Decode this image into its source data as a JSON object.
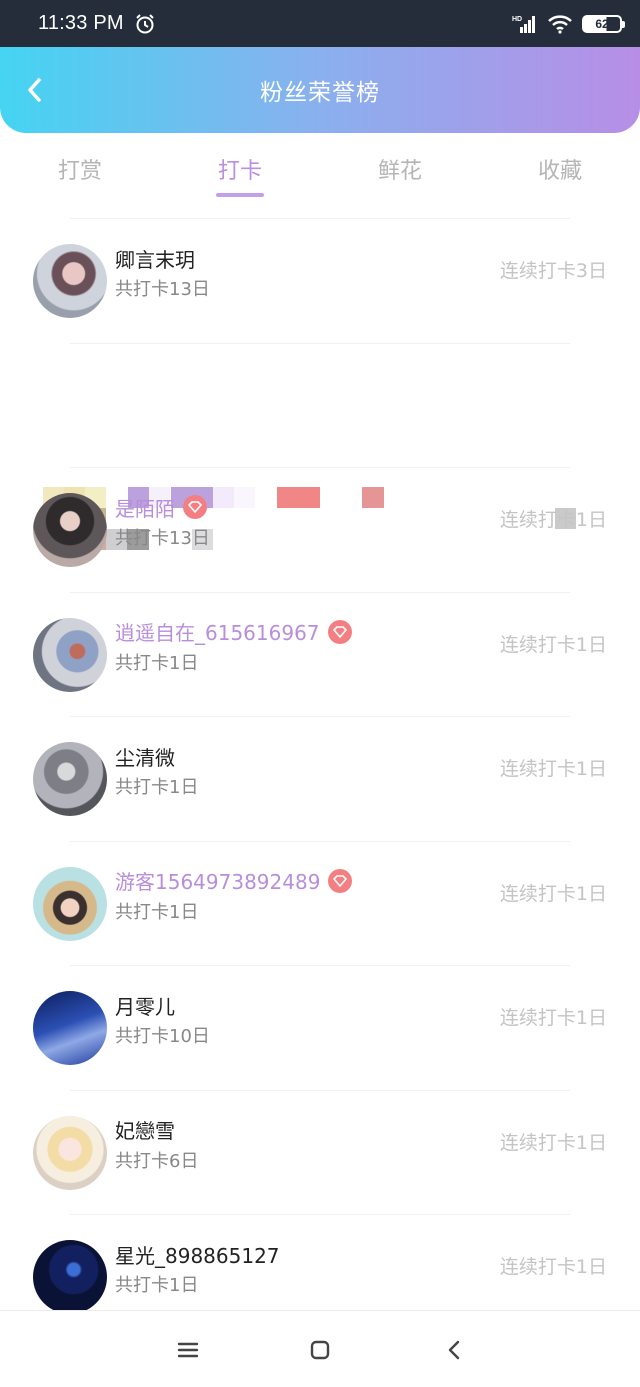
{
  "status_bar": {
    "time": "11:33 PM",
    "battery": "62",
    "network": "HD"
  },
  "header": {
    "title": "粉丝荣誉榜"
  },
  "tabs": [
    {
      "label": "打赏",
      "active": false
    },
    {
      "label": "打卡",
      "active": true
    },
    {
      "label": "鲜花",
      "active": false
    },
    {
      "label": "收藏",
      "active": false
    }
  ],
  "fans": [
    {
      "name": "卿言末玥",
      "total": "共打卡13日",
      "streak": "连续打卡3日",
      "vip": false
    },
    {
      "name": "",
      "total": "",
      "streak": "",
      "vip": false,
      "obscured": true
    },
    {
      "name": "是陌陌",
      "total": "共打卡13日",
      "streak": "连续打卡1日",
      "vip": true
    },
    {
      "name": "逍遥自在_615616967",
      "total": "共打卡1日",
      "streak": "连续打卡1日",
      "vip": true
    },
    {
      "name": "尘清微",
      "total": "共打卡1日",
      "streak": "连续打卡1日",
      "vip": false
    },
    {
      "name": "游客1564973892489",
      "total": "共打卡1日",
      "streak": "连续打卡1日",
      "vip": true
    },
    {
      "name": "月零儿",
      "total": "共打卡10日",
      "streak": "连续打卡1日",
      "vip": false
    },
    {
      "name": "妃戀雪",
      "total": "共打卡6日",
      "streak": "连续打卡1日",
      "vip": false
    },
    {
      "name": "星光_898865127",
      "total": "共打卡1日",
      "streak": "连续打卡1日",
      "vip": false
    }
  ],
  "colors": {
    "accent": "#ba8fe0",
    "vip_badge": "#f47f83",
    "header_start": "#45d4f2",
    "header_end": "#b78ee6"
  }
}
